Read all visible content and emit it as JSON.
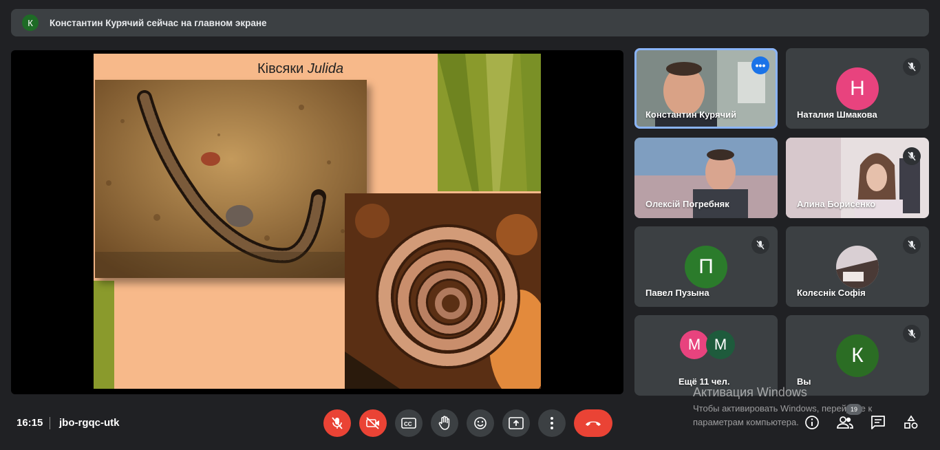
{
  "banner": {
    "avatar_letter": "К",
    "text": "Константин Курячий сейчас на главном экране"
  },
  "slide": {
    "title_main": "Ківсяки ",
    "title_italic": "Julida"
  },
  "participants": [
    {
      "name": "Константин Курячий",
      "type": "video",
      "active": true
    },
    {
      "name": "Наталия Шмакова",
      "type": "avatar",
      "letter": "Н",
      "color": "#e8437e"
    },
    {
      "name": "Олексій Погребняк",
      "type": "video"
    },
    {
      "name": "Алина Борисенко",
      "type": "video"
    },
    {
      "name": "Павел Пузына",
      "type": "avatar",
      "letter": "П",
      "color": "#2b7b2b"
    },
    {
      "name": "Колєснік Софія",
      "type": "photo-avatar"
    },
    {
      "name": "Ещё 11 чел.",
      "type": "group",
      "letters": [
        "М",
        "М"
      ]
    },
    {
      "name": "Вы",
      "type": "avatar",
      "letter": "К",
      "color": "#2b6d24"
    }
  ],
  "bottom": {
    "time": "16:15",
    "meeting_code": "jbo-rgqc-utk",
    "participants_badge": "19"
  },
  "watermark": {
    "line1": "Активация Windows",
    "line2": "Чтобы активировать Windows, перейдите к",
    "line3": "параметрам компьютера."
  },
  "colors": {
    "end_call": "#ea4335",
    "active_outline": "#8ab4f8",
    "background": "#202124"
  }
}
